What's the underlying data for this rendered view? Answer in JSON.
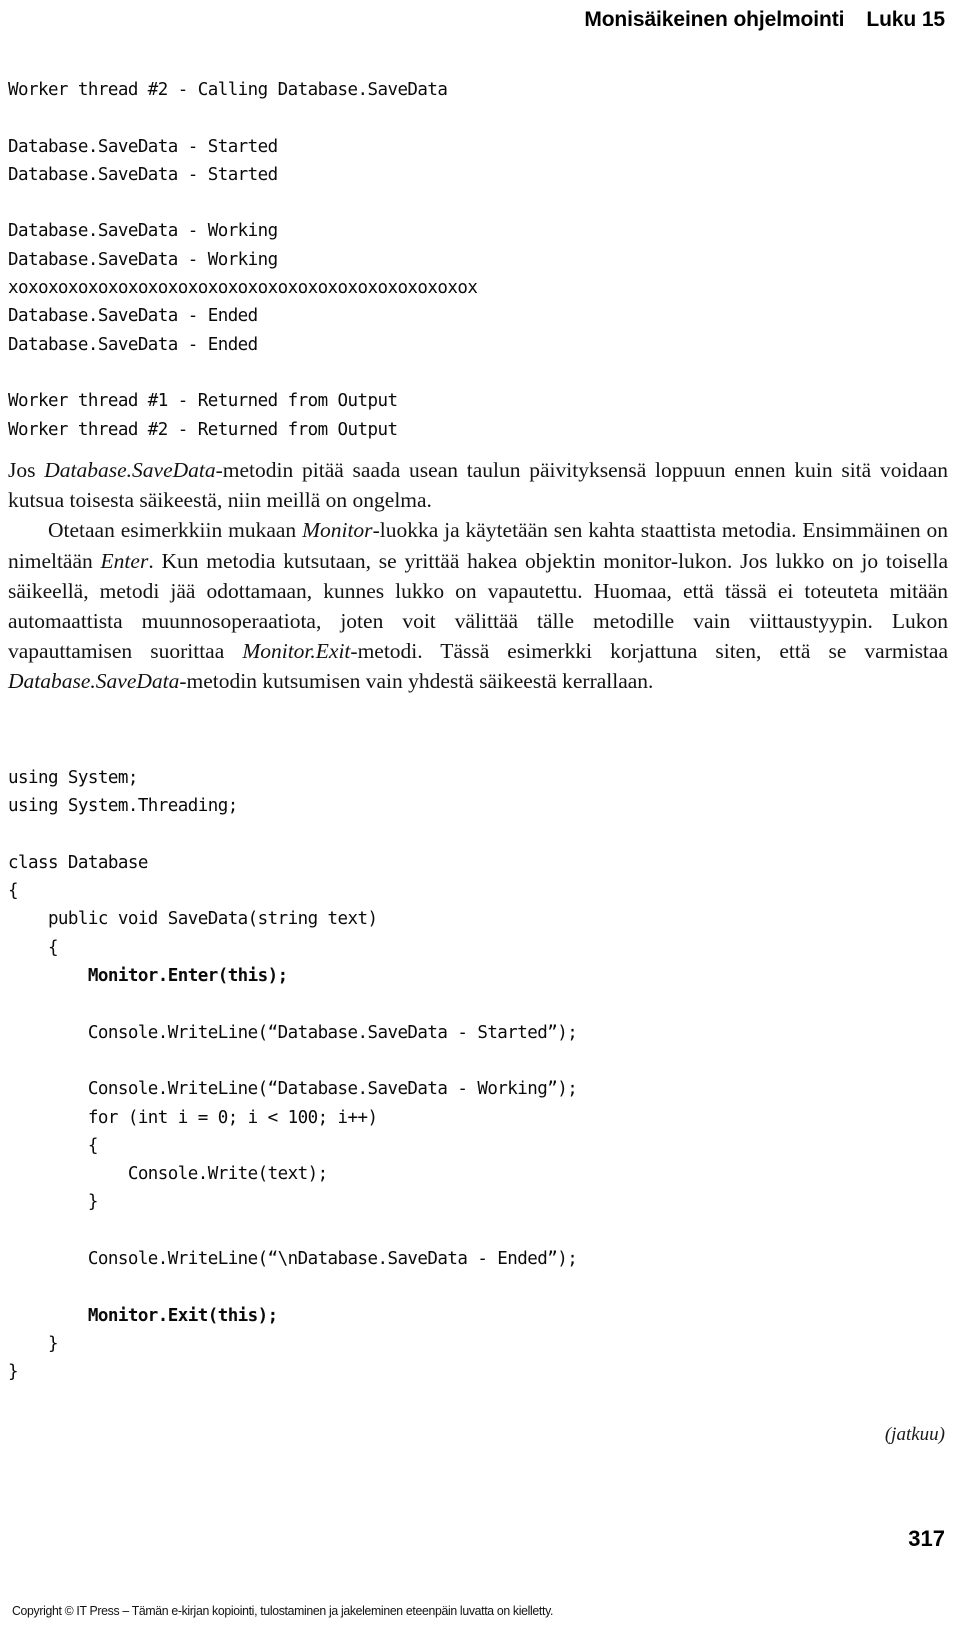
{
  "header": {
    "book_section": "Monisäikeinen ohjelmointi",
    "chapter": "Luku 15"
  },
  "console_output": {
    "lines": [
      "Worker thread #2 - Calling Database.SaveData",
      "",
      "Database.SaveData - Started",
      "Database.SaveData - Started",
      "",
      "Database.SaveData - Working",
      "Database.SaveData - Working",
      "xoxoxoxoxoxoxoxoxoxoxoxoxoxoxoxoxoxoxoxoxoxoxox",
      "Database.SaveData - Ended",
      "Database.SaveData - Ended",
      "",
      "Worker thread #1 - Returned from Output",
      "Worker thread #2 - Returned from Output"
    ]
  },
  "prose": {
    "paragraph_1": {
      "part_1": "Jos ",
      "italic_1": "Database.SaveData",
      "part_2": "-metodin pitää saada usean taulun päivityksensä loppuun ennen kuin sitä voidaan kutsua toisesta säikeestä, niin meillä on ongelma."
    },
    "paragraph_2": {
      "part_1": "Otetaan esimerkkiin mukaan ",
      "italic_1": "Monitor",
      "part_2": "-luokka ja käytetään sen kahta staattista metodia. Ensimmäinen on nimeltään ",
      "italic_2": "Enter",
      "part_3": ". Kun metodia kutsutaan, se yrittää hakea objektin monitor-lukon. Jos lukko on jo toisella säikeellä, metodi jää odottamaan, kunnes lukko on vapautettu. Huomaa, että tässä ei toteuteta mitään automaattista muunnosoperaatiota, joten voit välittää tälle metodille vain viittaustyypin. Lukon vapauttamisen suorittaa ",
      "italic_3": "Monitor.Exit",
      "part_4": "-metodi. Tässä esimerkki korjattuna siten, että se varmistaa ",
      "italic_4": "Database.SaveData",
      "part_5": "-metodin kutsumisen vain yhdestä säikeestä kerrallaan."
    }
  },
  "code_listing": {
    "lines": [
      {
        "text": "using System;",
        "bold": false
      },
      {
        "text": "using System.Threading;",
        "bold": false
      },
      {
        "text": "",
        "bold": false
      },
      {
        "text": "class Database",
        "bold": false
      },
      {
        "text": "{",
        "bold": false
      },
      {
        "text": "    public void SaveData(string text)",
        "bold": false
      },
      {
        "text": "    {",
        "bold": false
      },
      {
        "text": "        Monitor.Enter(this);",
        "bold": true
      },
      {
        "text": "",
        "bold": false
      },
      {
        "text": "        Console.WriteLine(“Database.SaveData - Started”);",
        "bold": false
      },
      {
        "text": "",
        "bold": false
      },
      {
        "text": "        Console.WriteLine(“Database.SaveData - Working”);",
        "bold": false
      },
      {
        "text": "        for (int i = 0; i < 100; i++)",
        "bold": false
      },
      {
        "text": "        {",
        "bold": false
      },
      {
        "text": "            Console.Write(text);",
        "bold": false
      },
      {
        "text": "        }",
        "bold": false
      },
      {
        "text": "",
        "bold": false
      },
      {
        "text": "        Console.WriteLine(“\\nDatabase.SaveData - Ended”);",
        "bold": false
      },
      {
        "text": "",
        "bold": false
      },
      {
        "text": "        Monitor.Exit(this);",
        "bold": true
      },
      {
        "text": "    }",
        "bold": false
      },
      {
        "text": "}",
        "bold": false
      }
    ]
  },
  "footer": {
    "continued_note": "(jatkuu)",
    "page_number": "317",
    "copyright": "Copyright © IT Press – Tämän e-kirjan kopiointi, tulostaminen ja jakeleminen eteenpäin luvatta on kielletty."
  }
}
